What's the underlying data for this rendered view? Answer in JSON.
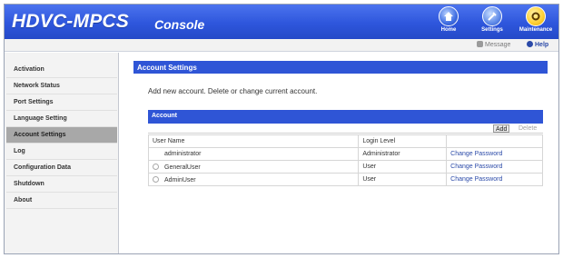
{
  "header": {
    "app_name": "HDVC-MPCS",
    "console_label": "Console",
    "nav": [
      {
        "label": "Home",
        "icon": "home-icon"
      },
      {
        "label": "Settings",
        "icon": "settings-icon"
      },
      {
        "label": "Maintenance",
        "icon": "maintenance-icon"
      }
    ],
    "message_label": "Message",
    "help_label": "Help"
  },
  "sidebar": {
    "items": [
      {
        "label": "Activation"
      },
      {
        "label": "Network Status"
      },
      {
        "label": "Port Settings"
      },
      {
        "label": "Language Setting"
      },
      {
        "label": "Account Settings"
      },
      {
        "label": "Log"
      },
      {
        "label": "Configuration Data"
      },
      {
        "label": "Shutdown"
      },
      {
        "label": "About"
      }
    ],
    "active_label": "Account Settings"
  },
  "main": {
    "section_title": "Account Settings",
    "intro": "Add new account. Delete or change current account.",
    "panel_title": "Account",
    "add_label": "Add",
    "delete_label": "Delete",
    "columns": [
      "User Name",
      "Login Level",
      ""
    ],
    "rows": [
      {
        "user": "administrator",
        "level": "Administrator",
        "action": "Change Password",
        "selectable": false
      },
      {
        "user": "GeneralUser",
        "level": "User",
        "action": "Change Password",
        "selectable": true
      },
      {
        "user": "AdminUser",
        "level": "User",
        "action": "Change Password",
        "selectable": true
      }
    ]
  },
  "colors": {
    "header_blue": "#2e56dc",
    "panel_blue": "#2f55d6",
    "link_blue": "#2b4aa8",
    "sidebar_active": "#a8a8a8"
  }
}
